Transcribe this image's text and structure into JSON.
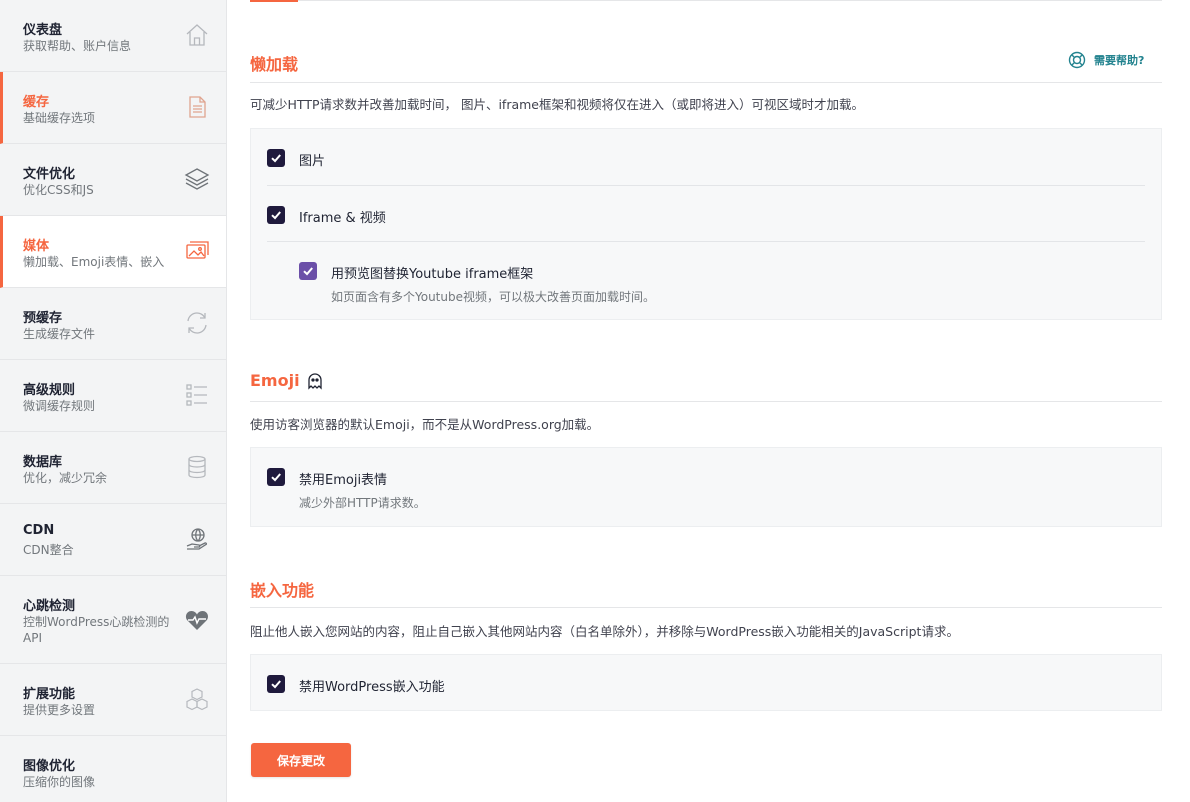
{
  "colors": {
    "accent": "#f56640",
    "checkbox": "#1f1a3d",
    "checkbox_sub": "#6b4fa8",
    "help": "#23838f"
  },
  "sidebar": {
    "items": [
      {
        "title": "仪表盘",
        "sub": "获取帮助、账户信息",
        "icon": "home-icon"
      },
      {
        "title": "缓存",
        "sub": "基础缓存选项",
        "icon": "page-icon"
      },
      {
        "title": "文件优化",
        "sub": "优化CSS和JS",
        "icon": "layers-icon"
      },
      {
        "title": "媒体",
        "sub": "懒加载、Emoji表情、嵌入",
        "icon": "images-icon"
      },
      {
        "title": "预缓存",
        "sub": "生成缓存文件",
        "icon": "refresh-icon"
      },
      {
        "title": "高级规则",
        "sub": "微调缓存规则",
        "icon": "rules-list-icon"
      },
      {
        "title": "数据库",
        "sub": "优化，减少冗余",
        "icon": "database-icon"
      },
      {
        "title": "CDN",
        "sub": "CDN整合",
        "icon": "globe-hand-icon"
      },
      {
        "title": "心跳检测",
        "sub": "控制WordPress心跳检测的API",
        "icon": "heartbeat-icon"
      },
      {
        "title": "扩展功能",
        "sub": "提供更多设置",
        "icon": "cubes-icon"
      },
      {
        "title": "图像优化",
        "sub": "压缩你的图像",
        "icon": "image-opt-icon"
      }
    ]
  },
  "help": {
    "label": "需要帮助?"
  },
  "lazyload": {
    "title": "懒加载",
    "desc": "可减少HTTP请求数并改善加载时间， 图片、iframe框架和视频将仅在进入（或即将进入）可视区域时才加载。",
    "opt_images": "图片",
    "opt_iframes": "Iframe & 视频",
    "opt_youtube": "用预览图替换Youtube iframe框架",
    "opt_youtube_help": "如页面含有多个Youtube视频，可以极大改善页面加载时间。"
  },
  "emoji": {
    "title": "Emoji",
    "desc": "使用访客浏览器的默认Emoji，而不是从WordPress.org加载。",
    "opt_disable": "禁用Emoji表情",
    "opt_disable_help": "减少外部HTTP请求数。"
  },
  "embeds": {
    "title": "嵌入功能",
    "desc": "阻止他人嵌入您网站的内容，阻止自己嵌入其他网站内容（白名单除外），并移除与WordPress嵌入功能相关的JavaScript请求。",
    "opt_disable": "禁用WordPress嵌入功能"
  },
  "save_label": "保存更改"
}
